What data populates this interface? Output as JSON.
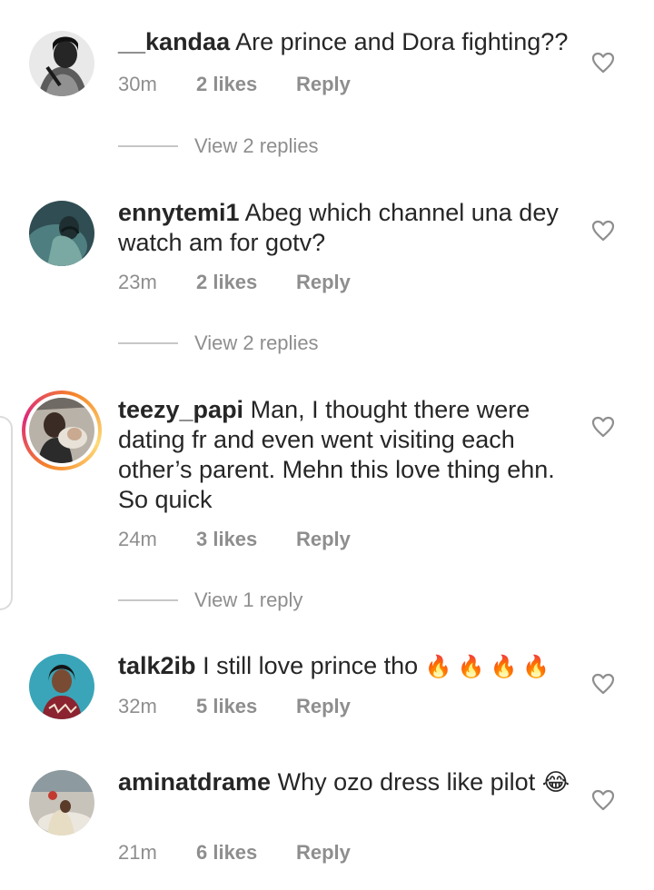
{
  "comments": [
    {
      "username": "__kandaa",
      "text": "Are prince and Dora fighting??",
      "time": "30m",
      "likes": "2 likes",
      "reply": "Reply",
      "view_replies": "View 2 replies"
    },
    {
      "username": "ennytemi1",
      "text": "Abeg which channel una dey watch am for gotv?",
      "time": "23m",
      "likes": "2 likes",
      "reply": "Reply",
      "view_replies": "View 2 replies"
    },
    {
      "username": "teezy_papi",
      "text": "Man, I thought there were dating fr and even went visiting each other’s parent. Mehn this love thing ehn. So quick",
      "time": "24m",
      "likes": "3 likes",
      "reply": "Reply",
      "view_replies": "View 1 reply"
    },
    {
      "username": "talk2ib",
      "text": "I still love prince tho",
      "emoji": "🔥🔥🔥🔥",
      "time": "32m",
      "likes": "5 likes",
      "reply": "Reply"
    },
    {
      "username": "aminatdrame",
      "text": "Why ozo dress like pilot",
      "emoji": "😂",
      "time": "21m",
      "likes": "6 likes",
      "reply": "Reply"
    }
  ],
  "icons": {
    "like": "heart-outline-icon"
  },
  "colors": {
    "text": "#262626",
    "meta": "#8e8e8e",
    "divider": "#c7c7c7",
    "story_ring_start": "#f58529",
    "story_ring_end": "#dd2a7b"
  }
}
